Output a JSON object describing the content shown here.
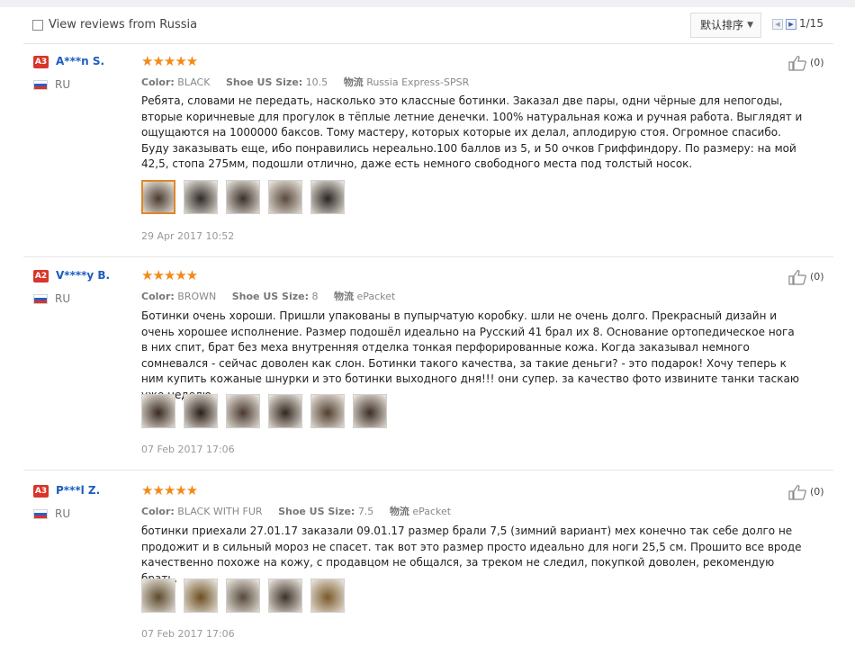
{
  "toolbar": {
    "filter_label": "View reviews from Russia",
    "sort_label": "默认排序",
    "page_indicator": "1/15"
  },
  "reviews": [
    {
      "level": "A3",
      "name": "A***n S.",
      "country": "RU",
      "rating": 5,
      "stars": "★★★★★",
      "color_label": "Color:",
      "color_value": "BLACK",
      "size_label": "Shoe US Size:",
      "size_value": "10.5",
      "logistics_label": "物流",
      "logistics_value": "Russia Express-SPSR",
      "text": "Ребята, словами не передать, насколько это классные ботинки. Заказал две пары, одни чёрные для непогоды, вторые коричневые для прогулок в тёплые летние денечки. 100% натуральная кожа и ручная работа. Выглядят и ощущаются на 1000000 баксов. Тому мастеру, которых которые их делал, аплодирую стоя. Огромное спасибо. Буду заказывать еще, ибо понравились нереально.100 баллов из 5, и 50 очков Гриффиндору. По размеру: на мой 42,5, стопа 275мм, подошли отлично, даже есть немного свободного места под толстый носок.",
      "photos": [
        "#4a3a2e",
        "#2f2a26",
        "#3b3029",
        "#5a4a3e",
        "#2b2522"
      ],
      "date": "29 Apr 2017 10:52",
      "helpful_count": "(0)"
    },
    {
      "level": "A2",
      "name": "V****y B.",
      "country": "RU",
      "rating": 5,
      "stars": "★★★★★",
      "color_label": "Color:",
      "color_value": "BROWN",
      "size_label": "Shoe US Size:",
      "size_value": "8",
      "logistics_label": "物流",
      "logistics_value": "ePacket",
      "text": "Ботинки очень хороши. Пришли упакованы в пупырчатую коробку. шли не очень долго. Прекрасный дизайн и очень хорошее исполнение. Размер подошёл идеально на Русский 41 брал их 8. Основание ортопедическое нога в них спит, брат без меха внутренняя отделка тонкая перфорированные кожа. Когда заказывал немного сомневался - сейчас доволен как слон. Ботинки такого качества, за такие деньги? - это подарок! Хочу теперь к ним купить кожаные шнурки и это ботинки выходного дня!!! они супер. за качество фото извините танки таскаю уже неделю.",
      "photos": [
        "#3a2b22",
        "#2a1f18",
        "#4a3a30",
        "#33271f",
        "#52402f",
        "#3d2e25"
      ],
      "date": "07 Feb 2017 17:06",
      "helpful_count": "(0)"
    },
    {
      "level": "A3",
      "name": "P***l Z.",
      "country": "RU",
      "rating": 5,
      "stars": "★★★★★",
      "color_label": "Color:",
      "color_value": "BLACK WITH FUR",
      "size_label": "Shoe US Size:",
      "size_value": "7.5",
      "logistics_label": "物流",
      "logistics_value": "ePacket",
      "text": "ботинки приехали 27.01.17 заказали 09.01.17 размер брали 7,5 (зимний вариант) мех конечно так себе долго не продожит и в сильный мороз не спасет. так вот это размер просто идеально для ноги 25,5 см. Прошито все вроде качественно похоже на кожу, с продавцом не общался, за треком не следил, покупкой доволен, рекомендую брать.",
      "photos": [
        "#5c4a2e",
        "#6b4f22",
        "#574a3c",
        "#3d3229",
        "#7a5a2a"
      ],
      "date": "07 Feb 2017 17:06",
      "helpful_count": "(0)"
    }
  ]
}
